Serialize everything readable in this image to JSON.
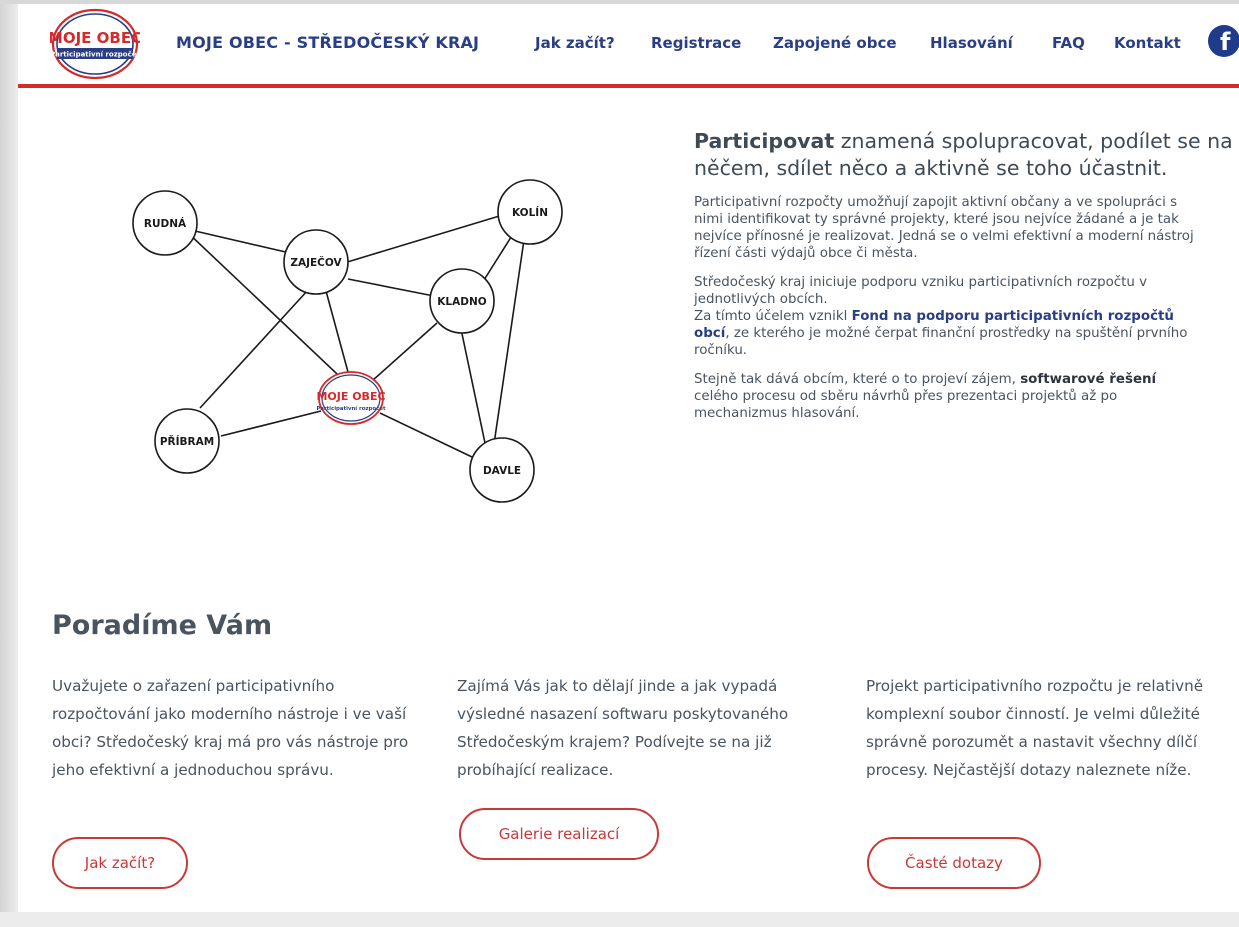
{
  "header": {
    "logo_line1": "MOJE OBEC",
    "logo_line2": "Participativní rozpočet",
    "site_title": "MOJE OBEC - STŘEDOČESKÝ KRAJ",
    "nav": [
      {
        "label": "Jak začít?"
      },
      {
        "label": "Registrace"
      },
      {
        "label": "Zapojené obce"
      },
      {
        "label": "Hlasování"
      },
      {
        "label": "FAQ"
      },
      {
        "label": "Kontakt"
      }
    ],
    "facebook_icon": "facebook-icon"
  },
  "network": {
    "center_line1": "MOJE OBEC",
    "center_line2": "Participativní rozpočet",
    "nodes": [
      {
        "id": "rudna",
        "label": "RUDNÁ"
      },
      {
        "id": "zajecov",
        "label": "ZAJEČOV"
      },
      {
        "id": "kolin",
        "label": "KOLÍN"
      },
      {
        "id": "kladno",
        "label": "KLADNO"
      },
      {
        "id": "pribram",
        "label": "PŘÍBRAM"
      },
      {
        "id": "davle",
        "label": "DAVLE"
      }
    ]
  },
  "intro": {
    "lead_bold": "Participovat",
    "lead_rest": " znamená spolupracovat, podílet se na něčem, sdílet něco a aktivně se toho účastnit.",
    "p1": "Participativní rozpočty umožňují zapojit aktivní občany a ve spolupráci s nimi identifikovat ty správné projekty, které jsou nejvíce žádané a je tak nejvíce přínosné je realizovat. Jedná se o velmi efektivní a moderní nástroj řízení části výdajů obce či města.",
    "p2_a": "Středočeský kraj iniciuje podporu vzniku participativních rozpočtu v jednotlivých obcích.",
    "p2_b": "Za tímto účelem vznikl ",
    "p2_link": "Fond na podporu participativních rozpočtů obcí",
    "p2_c": ", ze kterého je možné čerpat finanční prostředky na spuštění prvního ročníku.",
    "p3_a": "Stejně tak dává obcím, které o to projeví zájem, ",
    "p3_bold": "softwarové řešení",
    "p3_b": " celého procesu od sběru návrhů přes prezentaci projektů až po mechanizmus hlasování."
  },
  "advise": {
    "title": "Poradíme Vám",
    "columns": [
      {
        "text": "Uvažujete o zařazení participativního rozpočtování jako moderního nástroje i ve vaší obci? Středočeský kraj má pro vás nástroje pro jeho efektivní a jednoduchou správu.",
        "button": "Jak začít?"
      },
      {
        "text": "Zajímá Vás jak to dělají jinde a jak vypadá výsledné nasazení softwaru poskytovaného Středočeským krajem? Podívejte se na již probíhající realizace.",
        "button": "Galerie realizací"
      },
      {
        "text": "Projekt participativního rozpočtu je relativně komplexní soubor činností. Je velmi důležité správně porozumět a nastavit všechny dílčí procesy. Nejčastější dotazy naleznete níže.",
        "button": "Časté dotazy"
      }
    ]
  },
  "colors": {
    "brand_blue": "#2a3e86",
    "brand_red": "#d42a2a",
    "text": "#4a5360"
  }
}
